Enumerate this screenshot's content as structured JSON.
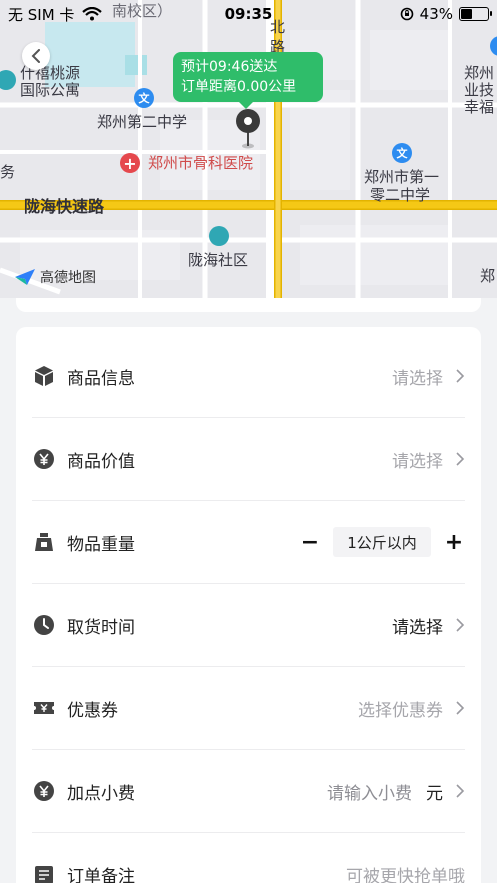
{
  "status_bar": {
    "carrier": "无 SIM 卡",
    "time": "09:35",
    "battery": "43%",
    "battery_level": 0.43
  },
  "map": {
    "eta_line1": "预计09:46送达",
    "eta_line2": "订单距离0.00公里",
    "provider": "高德地图",
    "labels": {
      "top_partial": "南校区）",
      "apartment_1": "什禧桃源",
      "apartment_2": "国际公寓",
      "school_2": "郑州第二中学",
      "hospital": "郑州市骨科医院",
      "road_main": "陇海快速路",
      "school_102_1": "郑州市第一",
      "school_102_2": "零二中学",
      "community": "陇海社区",
      "left_partial": "务",
      "right_1": "郑州",
      "right_2": "业技",
      "right_3": "幸福",
      "right_bottom": "郑",
      "north_road_1": "北",
      "north_road_2": "路",
      "poi_school_glyph": "文"
    }
  },
  "form": {
    "rows": [
      {
        "label": "商品信息",
        "value": "请选择"
      },
      {
        "label": "商品价值",
        "value": "请选择"
      },
      {
        "label": "物品重量",
        "value": "1公斤以内",
        "minus": "−",
        "plus": "+"
      },
      {
        "label": "取货时间",
        "value": "请选择"
      },
      {
        "label": "优惠券",
        "value": "选择优惠券"
      },
      {
        "label": "加点小费",
        "placeholder": "请输入小费",
        "unit": "元"
      },
      {
        "label": "订单备注",
        "placeholder": "可被更快抢单哦"
      }
    ]
  },
  "colors": {
    "accent_green": "#2fbd6a",
    "road_yellow": "#f5c816",
    "poi_blue": "#2d8cf0",
    "poi_red": "#e5484d"
  }
}
